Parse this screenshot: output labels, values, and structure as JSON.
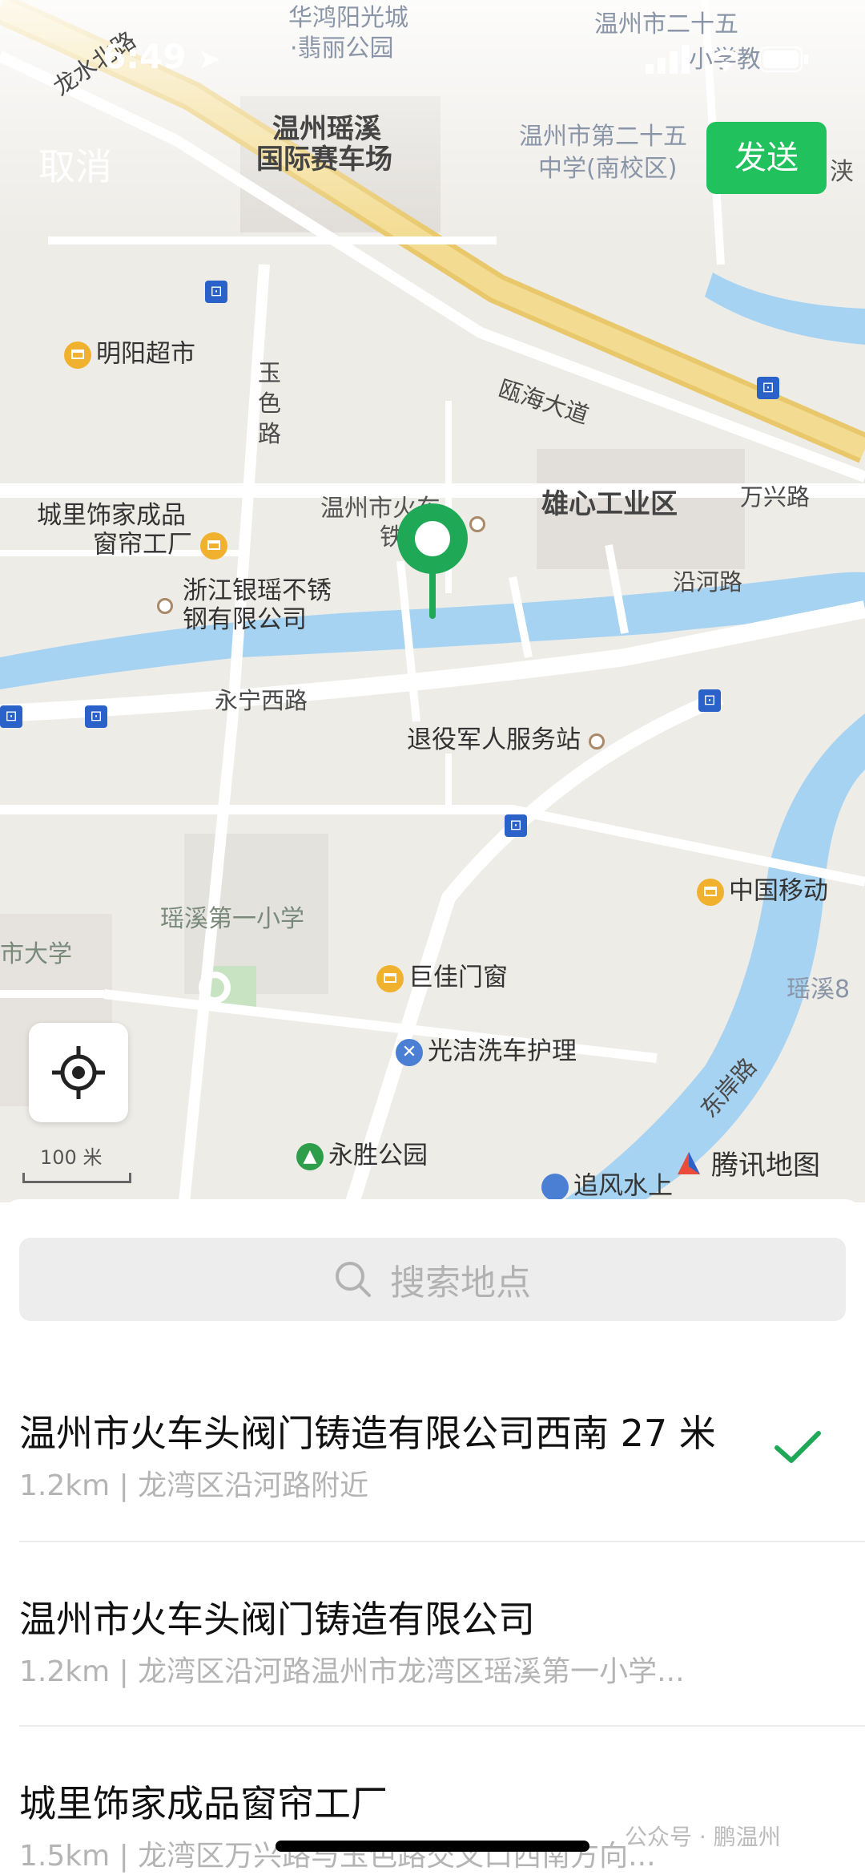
{
  "status_bar": {
    "time": "6:49"
  },
  "header": {
    "cancel_label": "取消",
    "send_label": "发送"
  },
  "map": {
    "labels": {
      "huahong": "华鸿阳光城",
      "feili": "·翡丽公园",
      "wz25a": "温州市二十五",
      "wz25b": "小学教",
      "yaoxi_a": "温州瑶溪",
      "yaoxi_b": "国际赛车场",
      "wz25c": "温州市第二十五",
      "wz25d": "中学(南校区)",
      "longshui": "龙水北路",
      "jia": "浃",
      "mingyang": "明阳超市",
      "yuselu": "玉\n色\n路",
      "ouhai": "瓯海大道",
      "wzhuoche": "温州市火车",
      "tie": "铁",
      "xiongxin": "雄心工业区",
      "wanxing": "万兴路",
      "chengli_a": "城里饰家成品",
      "chengli_b": "窗帘工厂",
      "zhejiang_a": "浙江银瑶不锈",
      "zhejiang_b": "钢有限公司",
      "yanhe": "沿河路",
      "yongning": "永宁西路",
      "tuiyi": "退役军人服务站",
      "yaoxi1": "瑶溪第一小学",
      "chinamobile": "中国移动",
      "shida": "市大学",
      "jujia": "巨佳门窗",
      "yaoxi8": "瑶溪8",
      "guangjie": "光洁洗车护理",
      "dongan": "东岸路",
      "yongsheng": "永胜公园",
      "zhuifeng": "追风水上"
    },
    "scale_label": "100 米",
    "brand": "腾讯地图"
  },
  "search": {
    "placeholder": "搜索地点"
  },
  "results": [
    {
      "title": "温州市火车头阀门铸造有限公司西南 27 米",
      "subtitle": "1.2km | 龙湾区沿河路附近",
      "selected": true
    },
    {
      "title": "温州市火车头阀门铸造有限公司",
      "subtitle": "1.2km | 龙湾区沿河路温州市龙湾区瑶溪第一小学...",
      "selected": false
    },
    {
      "title": "城里饰家成品窗帘工厂",
      "subtitle": "1.5km | 龙湾区万兴路与玉色路交叉口西南方向...",
      "selected": false
    }
  ],
  "watermark": "公众号 · 鹏温州",
  "colors": {
    "accent": "#21c15d",
    "river": "#a7d3f2",
    "pin": "#1fa855"
  }
}
